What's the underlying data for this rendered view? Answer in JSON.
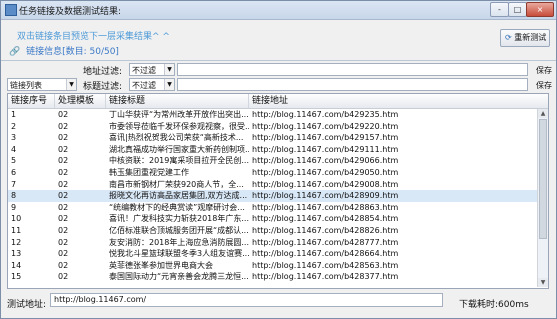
{
  "window": {
    "title": "任务链接及数据测试结果:",
    "controls": [
      "-",
      "□",
      "×"
    ]
  },
  "hint": "双击链接条目预览下一层采集结果^ ^",
  "refresh_label": "重新测试",
  "tab_label": "链接信息[数目: 50/50]",
  "filters": {
    "address_label": "地址过滤:",
    "address_mode": "不过滤",
    "title_label": "标题过滤:",
    "title_mode": "不过滤",
    "list_type": "链接列表",
    "save_label": "保存"
  },
  "table": {
    "columns": [
      "链接序号",
      "处理模板",
      "链接标题",
      "链接地址"
    ],
    "rows": [
      {
        "id": "1",
        "tpl": "02",
        "title": "丁山华获评“为常州改革开放作出突出...",
        "url": "http://blog.11467.com/b429235.htm"
      },
      {
        "id": "2",
        "tpl": "02",
        "title": "市委领导莅临千发环保参观视察，很受...",
        "url": "http://blog.11467.com/b429220.htm"
      },
      {
        "id": "3",
        "tpl": "02",
        "title": "喜讯|热烈祝贺我公司荣获“高新技术...",
        "url": "http://blog.11467.com/b429157.htm"
      },
      {
        "id": "4",
        "tpl": "02",
        "title": "湖北真福成功举行国家重大新药创制项...",
        "url": "http://blog.11467.com/b429111.htm"
      },
      {
        "id": "5",
        "tpl": "02",
        "title": "中核资联：2019寓采项目拉开全民创...",
        "url": "http://blog.11467.com/b429066.htm"
      },
      {
        "id": "6",
        "tpl": "02",
        "title": "韩玉集团重视党建工作",
        "url": "http://blog.11467.com/b429050.htm"
      },
      {
        "id": "7",
        "tpl": "02",
        "title": "南昌市新钢材厂荣获920商人节，全...",
        "url": "http://blog.11467.com/b429008.htm"
      },
      {
        "id": "8",
        "tpl": "02",
        "title": "报晓文化再访高品家居集团,双方达成...",
        "url": "http://blog.11467.com/b428909.htm"
      },
      {
        "id": "9",
        "tpl": "02",
        "title": "“统编教材下的经典赏读”观摩研讨会...",
        "url": "http://blog.11467.com/b428863.htm"
      },
      {
        "id": "10",
        "tpl": "02",
        "title": "喜讯！广发科技实力斩获2018年广东...",
        "url": "http://blog.11467.com/b428854.htm"
      },
      {
        "id": "11",
        "tpl": "02",
        "title": "亿佰标准联合顶城服务团开展“成都认...",
        "url": "http://blog.11467.com/b428826.htm"
      },
      {
        "id": "12",
        "tpl": "02",
        "title": "友安消防：2018年上海应急消防展圆...",
        "url": "http://blog.11467.com/b428777.htm"
      },
      {
        "id": "13",
        "tpl": "02",
        "title": "悦我北斗星篮球联盟冬季3人组友谊赛...",
        "url": "http://blog.11467.com/b428664.htm"
      },
      {
        "id": "14",
        "tpl": "02",
        "title": "英菲德张峯参加世界电商大会",
        "url": "http://blog.11467.com/b428563.htm"
      },
      {
        "id": "15",
        "tpl": "02",
        "title": "泰国国际动力“元宵亲善会龙腾三龙恒...",
        "url": "http://blog.11467.com/b428377.htm"
      }
    ],
    "selected_index": 7
  },
  "footer": {
    "test_label": "测试地址:",
    "test_url": "http://blog.11467.com/",
    "elapsed": "下载耗时:600ms"
  }
}
